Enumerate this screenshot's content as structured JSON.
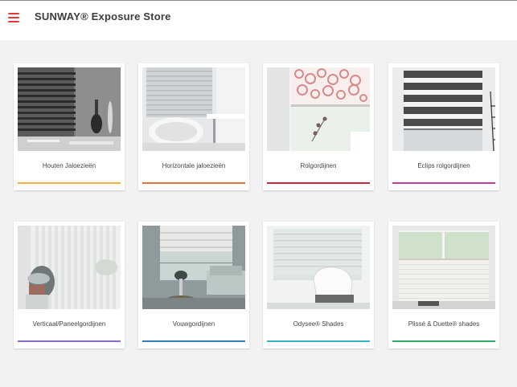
{
  "header": {
    "title": "SUNWAY® Exposure Store",
    "menu_icon": "hamburger-menu-icon"
  },
  "colors": {
    "accent": "#e53935",
    "background": "#f2f2f2",
    "card": "#ffffff"
  },
  "products": [
    {
      "label": "Houten Jaloezieën",
      "accent": "#f0b43c"
    },
    {
      "label": "Horizontale jaloezieën",
      "accent": "#e8743b"
    },
    {
      "label": "Rolgordijnen",
      "accent": "#c8283c"
    },
    {
      "label": "Eclips rolgordijnen",
      "accent": "#c03ca0"
    },
    {
      "label": "Verticaal/Paneelgordijnen",
      "accent": "#8c6ac8"
    },
    {
      "label": "Vouwgordijnen",
      "accent": "#2f7fbe"
    },
    {
      "label": "Odysee® Shades",
      "accent": "#3cb4c8"
    },
    {
      "label": "Plissé & Duette® shades",
      "accent": "#2fae6a"
    }
  ]
}
